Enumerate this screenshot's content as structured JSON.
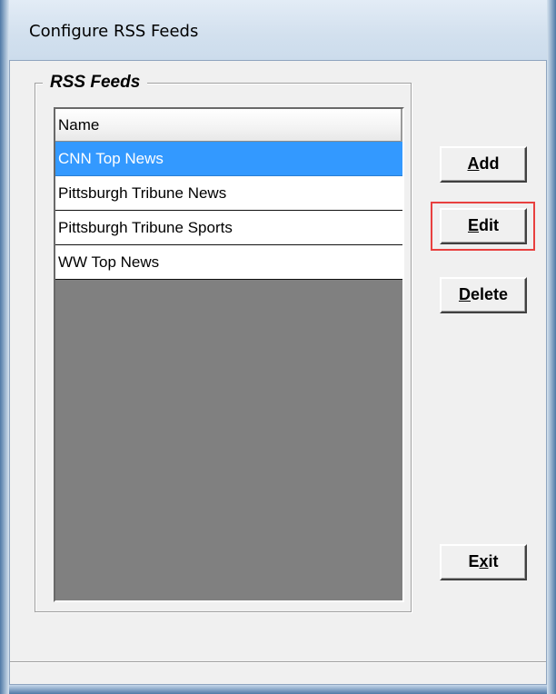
{
  "window": {
    "title": "Configure RSS Feeds"
  },
  "group": {
    "legend": "RSS Feeds"
  },
  "list": {
    "header": "Name",
    "rows": [
      {
        "name": "CNN Top News",
        "selected": true
      },
      {
        "name": "Pittsburgh Tribune News",
        "selected": false
      },
      {
        "name": "Pittsburgh Tribune Sports",
        "selected": false
      },
      {
        "name": "WW Top News",
        "selected": false
      }
    ]
  },
  "buttons": {
    "add": {
      "mnemonic": "A",
      "rest": "dd"
    },
    "edit": {
      "mnemonic": "E",
      "rest": "dit"
    },
    "delete": {
      "mnemonic": "D",
      "rest": "elete"
    },
    "exit": {
      "pre": "E",
      "mnemonic": "x",
      "rest": "it"
    }
  },
  "colors": {
    "selection": "#3399ff",
    "highlight_box": "#e8403f",
    "list_background": "#808080"
  }
}
